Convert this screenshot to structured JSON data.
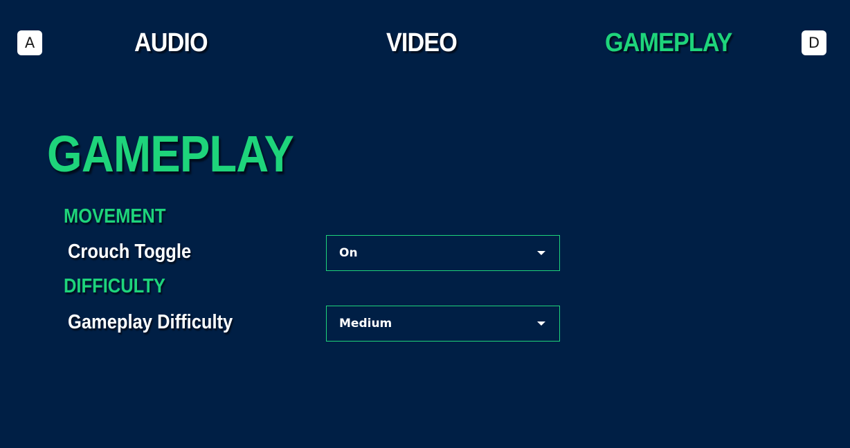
{
  "colors": {
    "background": "#001f45",
    "accent": "#1ed47b",
    "text": "#ffffff"
  },
  "nav": {
    "prev_key": "A",
    "next_key": "D",
    "tabs": [
      {
        "label": "AUDIO",
        "active": false
      },
      {
        "label": "VIDEO",
        "active": false
      },
      {
        "label": "GAMEPLAY",
        "active": true
      }
    ]
  },
  "page": {
    "title": "GAMEPLAY"
  },
  "sections": [
    {
      "heading": "MOVEMENT",
      "settings": [
        {
          "label": "Crouch Toggle",
          "value": "On",
          "icon": "chevron-down-icon"
        }
      ]
    },
    {
      "heading": "DIFFICULTY",
      "settings": [
        {
          "label": "Gameplay Difficulty",
          "value": "Medium",
          "icon": "chevron-down-icon"
        }
      ]
    }
  ]
}
